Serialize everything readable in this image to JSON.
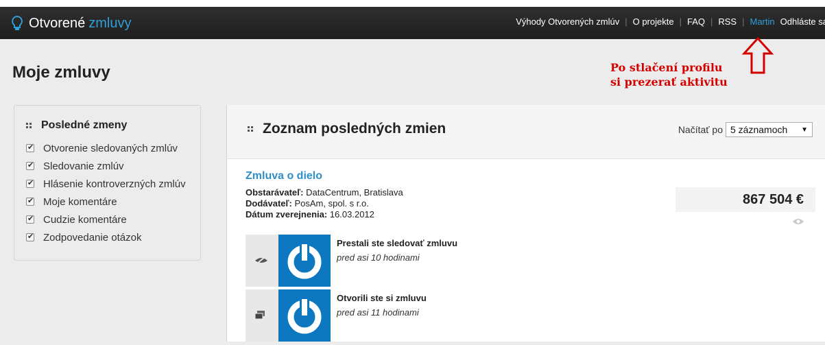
{
  "brand": {
    "part1": "Otvorené",
    "part2": "zmluvy"
  },
  "nav": {
    "items": [
      "Výhody Otvorených zmlúv",
      "O projekte",
      "FAQ",
      "RSS"
    ],
    "user": "Martin",
    "logout": "Odhláste sa"
  },
  "page_title": "Moje zmluvy",
  "annotation": {
    "line1": "Po stlačení profilu",
    "line2": "si prezerať aktivitu"
  },
  "sidebar": {
    "title": "Posledné zmeny",
    "items": [
      {
        "label": "Otvorenie sledovaných zmlúv",
        "checked": true
      },
      {
        "label": "Sledovanie zmlúv",
        "checked": true
      },
      {
        "label": "Hlásenie kontroverzných zmlúv",
        "checked": true
      },
      {
        "label": "Moje komentáre",
        "checked": true
      },
      {
        "label": "Cudzie komentáre",
        "checked": true
      },
      {
        "label": "Zodpovedanie otázok",
        "checked": true
      }
    ]
  },
  "main": {
    "title": "Zoznam posledných zmien",
    "load_label": "Načítať po",
    "load_value": "5 záznamoch",
    "contract": {
      "title": "Zmluva o dielo",
      "obstaravatel_label": "Obstarávateľ:",
      "obstaravatel": "DataCentrum, Bratislava",
      "dodavatel_label": "Dodávateľ:",
      "dodavatel": "PosAm, spol. s r.o.",
      "datum_label": "Dátum zverejnenia:",
      "datum": "16.03.2012",
      "price": "867 504 €"
    },
    "activities": [
      {
        "title": "Prestali ste sledovať zmluvu",
        "when": "pred asi 10 hodinami",
        "icon": "eye-slash-icon"
      },
      {
        "title": "Otvorili ste si zmluvu",
        "when": "pred asi 11 hodinami",
        "icon": "open-document-icon"
      }
    ]
  },
  "colors": {
    "accent": "#2e9fd8",
    "annotation": "#d40000",
    "logo_bg": "#0d77c0",
    "topbar": "#262626"
  }
}
